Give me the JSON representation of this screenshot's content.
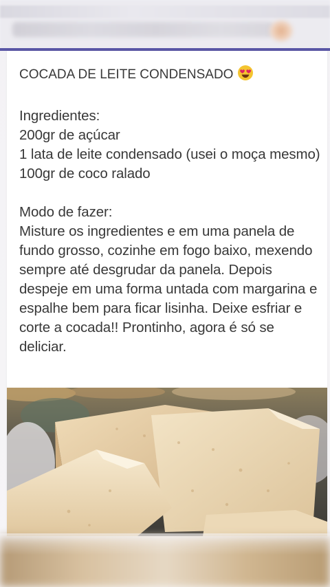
{
  "post": {
    "title": "COCADA DE LEITE CONDENSADO",
    "title_emoji": "heart-eyes-emoji",
    "ingredients_heading": "Ingredientes:",
    "ingredients": [
      "200gr de açúcar",
      "1 lata de leite condensado (usei o moça mesmo)",
      "100gr de coco ralado"
    ],
    "method_heading": "Modo de fazer:",
    "method": "Misture os ingredientes e em uma panela de fundo grosso, cozinhe em fogo baixo, mexendo sempre até desgrudar da panela. Depois despeje em uma forma untada com margarina e espalhe bem para ficar lisinha. Deixe esfriar e corte a cocada!! Prontinho, agora é só se deliciar."
  },
  "colors": {
    "accent_rule": "#5a57a6",
    "text": "#383838",
    "card": "#ffffff"
  }
}
